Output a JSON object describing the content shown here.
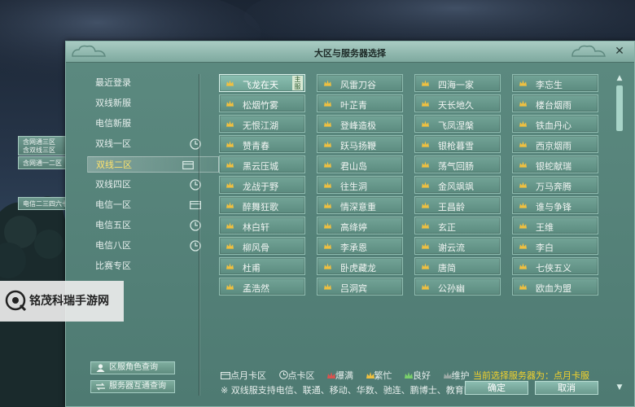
{
  "dialog": {
    "title": "大区与服务器选择",
    "close_icon": "close-icon"
  },
  "categories": [
    {
      "label": "最近登录",
      "icon": null
    },
    {
      "label": "双线新服",
      "icon": null
    },
    {
      "label": "电信新服",
      "icon": null
    },
    {
      "label": "双线一区",
      "icon": "clock-icon"
    },
    {
      "label": "双线二区",
      "icon": "card-icon",
      "active": true
    },
    {
      "label": "双线四区",
      "icon": "clock-icon"
    },
    {
      "label": "电信一区",
      "icon": "card-icon"
    },
    {
      "label": "电信五区",
      "icon": "clock-icon"
    },
    {
      "label": "电信八区",
      "icon": "clock-icon"
    },
    {
      "label": "比赛专区",
      "icon": null
    }
  ],
  "tags": [
    {
      "line1": "含网通三区",
      "line2": "含双线三区"
    },
    {
      "line1": "含网通一二区",
      "line2": ""
    },
    {
      "line1": "电信二三四六七区",
      "line2": ""
    }
  ],
  "servers": [
    {
      "name": "飞龙在天",
      "selected": true,
      "badge": "主服"
    },
    {
      "name": "风雷刀谷"
    },
    {
      "name": "四海一家"
    },
    {
      "name": "李忘生"
    },
    {
      "name": "松烟竹雾"
    },
    {
      "name": "叶芷青"
    },
    {
      "name": "天长地久"
    },
    {
      "name": "楼台烟雨"
    },
    {
      "name": "无恨江湖"
    },
    {
      "name": "登峰造极"
    },
    {
      "name": "飞凤涅槃"
    },
    {
      "name": "铁血丹心"
    },
    {
      "name": "赞青春"
    },
    {
      "name": "跃马扬鞭"
    },
    {
      "name": "银枪暮雪"
    },
    {
      "name": "西京烟雨"
    },
    {
      "name": "黑云压城"
    },
    {
      "name": "君山岛"
    },
    {
      "name": "荡气回肠"
    },
    {
      "name": "银蛇献瑞"
    },
    {
      "name": "龙战于野"
    },
    {
      "name": "往生洞"
    },
    {
      "name": "金风飒飒"
    },
    {
      "name": "万马奔腾"
    },
    {
      "name": "醉舞狂歌"
    },
    {
      "name": "情深意重"
    },
    {
      "name": "王昌龄"
    },
    {
      "name": "谁与争锋"
    },
    {
      "name": "林白轩"
    },
    {
      "name": "高绛婷"
    },
    {
      "name": "玄正"
    },
    {
      "name": "王维"
    },
    {
      "name": "柳风骨"
    },
    {
      "name": "李承恩"
    },
    {
      "name": "谢云流"
    },
    {
      "name": "李白"
    },
    {
      "name": "杜甫"
    },
    {
      "name": "卧虎藏龙"
    },
    {
      "name": "唐简"
    },
    {
      "name": "七侠五义"
    },
    {
      "name": "孟浩然"
    },
    {
      "name": "吕洞宾"
    },
    {
      "name": "公孙幽"
    },
    {
      "name": "欧血为盟"
    }
  ],
  "legend": {
    "monthly": "点月卡区",
    "timed": "点卡区",
    "full": "爆满",
    "busy": "繁忙",
    "good": "良好",
    "maintain": "维护",
    "colors": {
      "full": "#d9534f",
      "busy": "#f0c040",
      "good": "#7ad06b",
      "maintain": "#9aa9a5"
    }
  },
  "current_selection": "当前选择服务器为：点月卡服",
  "note": "※ 双线服支持电信、联通、移动、华数、驰连、鹏博士、教育网等",
  "buttons": {
    "ok": "确定",
    "cancel": "取消",
    "role_query": "区服角色查询",
    "interop_query": "服务器互通查询"
  },
  "watermark": "铭茂科瑞手游网"
}
